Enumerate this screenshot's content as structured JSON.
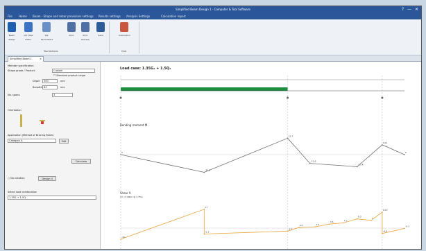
{
  "window": {
    "title": "Simplified Beam Design 1 - Computer & Tool Software",
    "ctl_help": "?",
    "ctl_min": "—",
    "ctl_close": "✕"
  },
  "menu": [
    "File",
    "Home",
    "Beam - Shape and rebar provisions settings",
    "Results settings",
    "Analysis Settings",
    "Calculation report"
  ],
  "ribbon": {
    "buttons": [
      {
        "label": "Beam design",
        "icon": "beam-design-icon",
        "color": "#1f5fb0"
      },
      {
        "label": "CLT Filter Editor",
        "icon": "filter-editor-icon",
        "color": "#3b72c4"
      },
      {
        "label": "SW Parameters",
        "icon": "parameters-icon",
        "color": "#6b8fc7"
      },
      {
        "label": "Print",
        "icon": "print-icon",
        "color": "#4d6fa3"
      },
      {
        "label": "Print Preview",
        "icon": "print-preview-icon",
        "color": "#4d6fa3"
      },
      {
        "label": "Save",
        "icon": "save-icon",
        "color": "#2e5c99"
      },
      {
        "label": "Calculation",
        "icon": "calculation-icon",
        "color": "#c8553d"
      }
    ],
    "groups": [
      "Tool Actions",
      "Calc"
    ]
  },
  "doc_tab": {
    "label": "Simplified Beam 1",
    "close": "×"
  },
  "left": {
    "member_spec": "Member specification",
    "shape": {
      "label": "Shape grade / Product:",
      "value": "Custom"
    },
    "standard": "Standard product range",
    "depth": {
      "label": "Depth",
      "value": "300",
      "unit": "mm"
    },
    "breadth": {
      "label": "Breadth",
      "value": "63",
      "unit": "mm"
    },
    "no_spans": {
      "label": "No. spans:",
      "value": "3"
    },
    "orientation": "Orientation",
    "app_label": "Application (Method of Bracing Beam)",
    "category": {
      "value": "Category A",
      "btn": "Edit"
    },
    "load_btn": "Calculate",
    "no_notation": "No notation",
    "beam_prop": "Design II",
    "load_combo": {
      "label": "Select load combination",
      "value": "1.35G + 1.5Q"
    }
  },
  "main": {
    "load_case": "Load case: 1.35G₁ + 1.5Q₁",
    "bending": "Bending moment M",
    "shear": "Shear V",
    "shear_sub": "V= / 5 kN/m @ 1.75m"
  },
  "colors": {
    "accent": "#2b579a",
    "load_bar": "#1e8e3e",
    "moment_line": "#6f6f6f",
    "shear_line": "#e8a33a",
    "ref_line": "#3a46c9"
  },
  "chart_data": [
    {
      "type": "line",
      "title": "Bending moment M",
      "x": [
        0,
        3.0,
        6.0,
        6.8,
        8.5,
        9.4,
        10.2
      ],
      "y": [
        0,
        -25.5,
        23.7,
        -12.6,
        -17.4,
        14.1,
        0
      ]
    },
    {
      "type": "line",
      "title": "Shear V",
      "x": [
        0,
        3.0,
        3.0,
        6.0,
        6.4,
        7.0,
        7.5,
        8.0,
        8.5,
        9.0,
        9.4,
        9.4,
        10.2
      ],
      "y": [
        -10,
        17,
        -5.3,
        -2.7,
        0.5,
        1.2,
        3.6,
        4.7,
        8.3,
        7.0,
        14.3,
        -4.8,
        -0.3
      ]
    }
  ]
}
